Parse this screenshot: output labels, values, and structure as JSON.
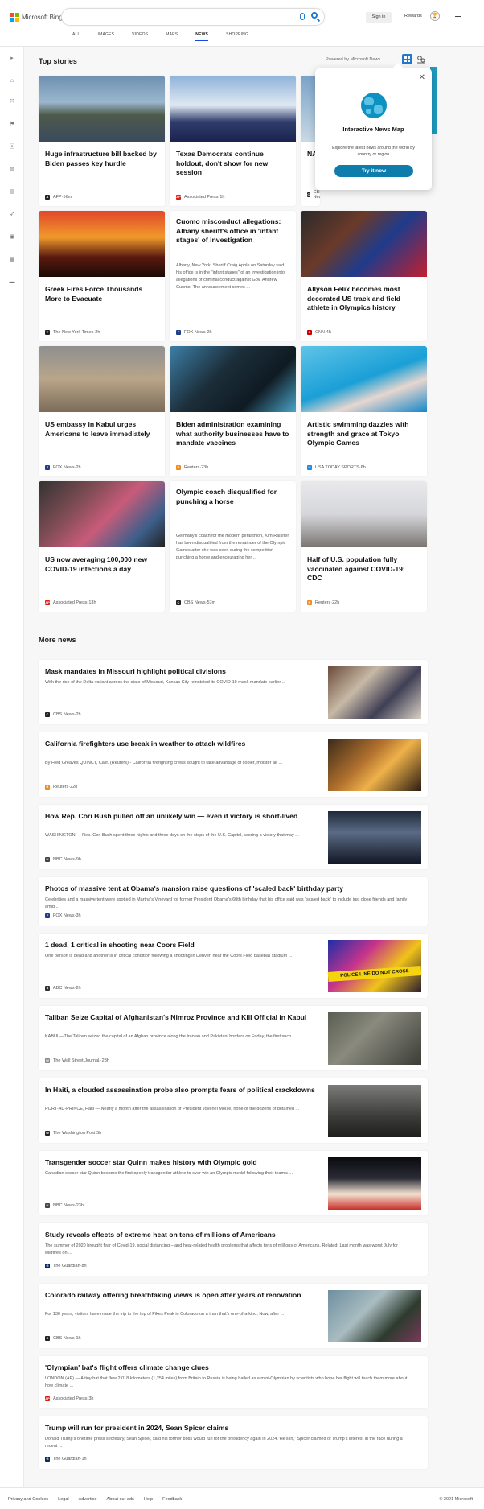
{
  "header": {
    "brand": "Microsoft Bing",
    "sign_in": "Sign in",
    "rewards": "Rewards",
    "nav": [
      "ALL",
      "IMAGES",
      "VIDEOS",
      "MAPS",
      "NEWS",
      "SHOPPING"
    ],
    "active_nav": "NEWS",
    "accent": "#174ae4"
  },
  "sidebar": {
    "icons": [
      "expand-icon",
      "home-icon",
      "trending-icon",
      "flag-icon",
      "location-icon",
      "globe-icon",
      "chart-icon",
      "rocket-icon",
      "film-icon",
      "briefcase-icon",
      "car-icon"
    ]
  },
  "top_stories": {
    "heading": "Top stories",
    "powered_by": "Powered by Microsoft News",
    "cards": [
      {
        "title": "Huge infrastructure bill backed by Biden passes key hurdle",
        "source": "AFP",
        "time": "56m",
        "src_color": "#222",
        "src_glyph": "A"
      },
      {
        "title": "Texas Democrats continue holdout, don't show for new session",
        "source": "Associated Press",
        "time": "1h",
        "src_color": "#d91e18",
        "src_glyph": "AP"
      },
      {
        "title": "NASA ... samp...",
        "source": "CBS News",
        "time": "4h",
        "src_color": "#222",
        "src_glyph": "C"
      },
      {
        "title": "Greek Fires Force Thousands More to Evacuate",
        "source": "The New York Times",
        "time": "2h",
        "src_color": "#222",
        "src_glyph": "T"
      },
      {
        "title": "Cuomo misconduct allegations: Albany sheriff's office in 'infant stages' of investigation",
        "desc": "Albany, New York, Sheriff Craig Apple on Saturday said his office is in the \"infant stages\" of an investigation into allegations of criminal conduct against Gov. Andrew Cuomo. The announcement comes ...",
        "source": "FOX News",
        "time": "2h",
        "src_color": "#1f3e8c",
        "src_glyph": "F"
      },
      {
        "title": "Allyson Felix becomes most decorated US track and field athlete in Olympics history",
        "source": "CNN",
        "time": "4h",
        "src_color": "#cc0000",
        "src_glyph": "C"
      },
      {
        "title": "US embassy in Kabul urges Americans to leave immediately",
        "source": "FOX News",
        "time": "2h",
        "src_color": "#1f3e8c",
        "src_glyph": "F"
      },
      {
        "title": "Biden administration examining what authority businesses have to mandate vaccines",
        "source": "Reuters",
        "time": "23h",
        "src_color": "#f08a24",
        "src_glyph": "R"
      },
      {
        "title": "Artistic swimming dazzles with strength and grace at Tokyo Olympic Games",
        "source": "USA TODAY SPORTS",
        "time": "6h",
        "src_color": "#1e88e5",
        "src_glyph": "U"
      },
      {
        "title": "US now averaging 100,000 new COVID-19 infections a day",
        "source": "Associated Press",
        "time": "13h",
        "src_color": "#d91e18",
        "src_glyph": "AP"
      },
      {
        "title": "Olympic coach disqualified for punching a horse",
        "desc": "Germany's coach for the modern pentathlon, Kim Raisner, has been disqualified from the remainder of the Olympic Games after she was seen during the competition punching a horse and encouraging her ...",
        "source": "CBS News",
        "time": "57m",
        "src_color": "#222",
        "src_glyph": "C"
      },
      {
        "title": "Half of U.S. population fully vaccinated against COVID-19: CDC",
        "source": "Reuters",
        "time": "22h",
        "src_color": "#f08a24",
        "src_glyph": "R"
      }
    ]
  },
  "popup": {
    "title": "Interactive News Map",
    "desc": "Explore the latest news around the world by country or region",
    "button": "Try it now"
  },
  "more_news": {
    "heading": "More news",
    "items": [
      {
        "title": "Mask mandates in Missouri highlight political divisions",
        "desc": "With the rise of the Delta variant across the state of Missouri, Kansas City reinstated its COVID-19 mask mandate earlier ...",
        "source": "CBS News",
        "time": "2h",
        "src_color": "#222",
        "src_glyph": "C",
        "has_image": true
      },
      {
        "title": "California firefighters use break in weather to attack wildfires",
        "desc": "By Fred Greaves QUINCY, Calif. (Reuters) - California firefighting crews sought to take advantage of cooler, moister air ...",
        "source": "Reuters",
        "time": "22h",
        "src_color": "#f08a24",
        "src_glyph": "R",
        "has_image": true
      },
      {
        "title": "How Rep. Cori Bush pulled off an unlikely win — even if victory is short-lived",
        "desc": "WASHINGTON — Rep. Cori Bush spent three nights and three days on the steps of the U.S. Capitol, scoring a victory that may ...",
        "source": "NBC News",
        "time": "9h",
        "src_color": "#444",
        "src_glyph": "N",
        "has_image": true
      },
      {
        "title": "Photos of massive tent at Obama's mansion raise questions of 'scaled back' birthday party",
        "desc": "Celebrities and a massive tent were spotted in Martha's Vineyard for former President Obama's 60th birthday that his office said was \"scaled back\" to include just close friends and family amid ...",
        "source": "FOX News",
        "time": "3h",
        "src_color": "#1f3e8c",
        "src_glyph": "F",
        "has_image": false
      },
      {
        "title": "1 dead, 1 critical in shooting near Coors Field",
        "desc": "One person is dead and another is in critical condition following a shooting in Denver, near the Coors Field baseball stadium ...",
        "source": "ABC News",
        "time": "2h",
        "src_color": "#333",
        "src_glyph": "a",
        "has_image": true,
        "image_text": "POLICE LINE DO NOT CROSS"
      },
      {
        "title": "Taliban Seize Capital of Afghanistan's Nimroz Province and Kill Official in Kabul",
        "desc": "KABUL—The Taliban seized the capital of an Afghan province along the Iranian and Pakistani borders on Friday, the first such ...",
        "source": "The Wall Street Journal.",
        "time": "23h",
        "src_color": "#888",
        "src_glyph": "W",
        "has_image": true
      },
      {
        "title": "In Haiti, a clouded assassination probe also prompts fears of political crackdowns",
        "desc": "PORT-AU-PRINCE, Haiti — Nearly a month after the assassination of President Jovenel Moïse, none of the dozens of detained ...",
        "source": "The Washington Post",
        "time": "5h",
        "src_color": "#222",
        "src_glyph": "W",
        "has_image": true
      },
      {
        "title": "Transgender soccer star Quinn makes history with Olympic gold",
        "desc": "Canadian soccer star Quinn became the first openly transgender athlete to ever win an Olympic medal following their team's ...",
        "source": "NBC News",
        "time": "23h",
        "src_color": "#444",
        "src_glyph": "N",
        "has_image": true
      },
      {
        "title": "Study reveals effects of extreme heat on tens of millions of Americans",
        "desc": "The summer of 2020 brought fear of Covid-19, social distancing – and heat-related health problems that affects tens of millions of Americans. Related: Last month was worst July for wildfires on ...",
        "source": "The Guardian",
        "time": "8h",
        "src_color": "#052962",
        "src_glyph": "G",
        "has_image": false
      },
      {
        "title": "Colorado railway offering breathtaking views is open after years of renovation",
        "desc": "For 130 years, visitors have made the trip to the top of Pikes Peak in Colorado on a train that's one-of-a-kind. Now, after ...",
        "source": "CBS News",
        "time": "1h",
        "src_color": "#222",
        "src_glyph": "C",
        "has_image": true
      },
      {
        "title": "'Olympian' bat's flight offers climate change clues",
        "desc": "LONDON (AP) — A tiny bat that flew 2,018 kilometers (1,254 miles) from Britain to Russia is being hailed as a mini-Olympian by scientists who hope her flight will teach them more about how climate ...",
        "source": "Associated Press",
        "time": "3h",
        "src_color": "#d91e18",
        "src_glyph": "AP",
        "has_image": false
      },
      {
        "title": "Trump will run for president in 2024, Sean Spicer claims",
        "desc": "Donald Trump's onetime press secretary, Sean Spicer, said his former boss would run for the presidency again in 2024.\"He's in,\" Spicer claimed of Trump's interest in the race during a recent ...",
        "source": "The Guardian",
        "time": "1h",
        "src_color": "#052962",
        "src_glyph": "G",
        "has_image": false
      }
    ]
  },
  "footer": {
    "links": [
      "Privacy and Cookies",
      "Legal",
      "Advertise",
      "About our ads",
      "Help",
      "Feedback"
    ],
    "copyright": "© 2021 Microsoft"
  }
}
